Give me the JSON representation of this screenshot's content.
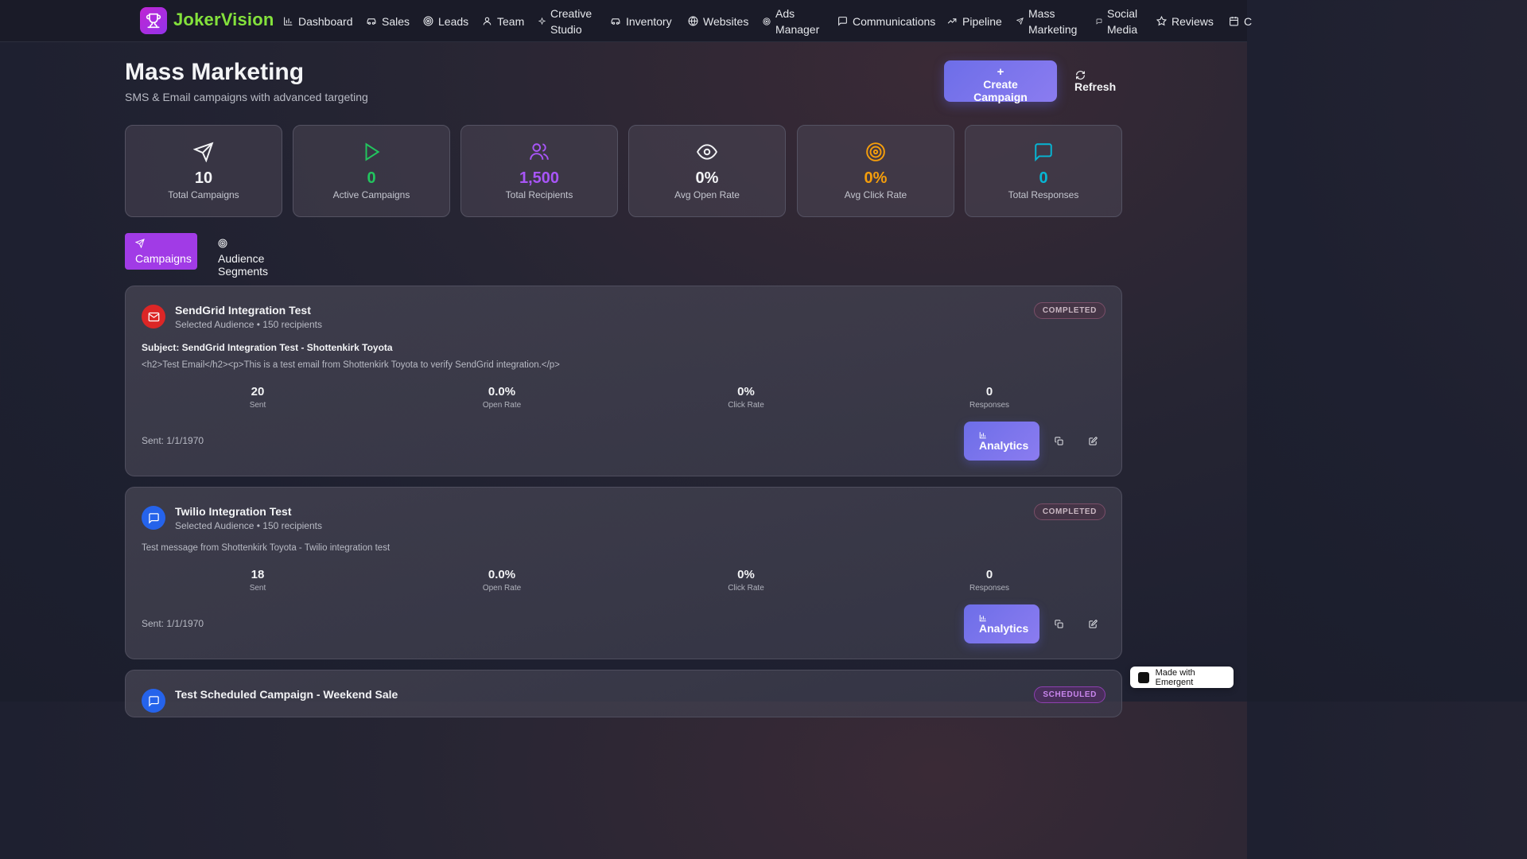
{
  "app": {
    "name": "JokerVision"
  },
  "nav": [
    {
      "label": "Dashboard",
      "icon": "bar-chart-icon"
    },
    {
      "label": "Sales",
      "icon": "car-icon"
    },
    {
      "label": "Leads",
      "icon": "target-icon"
    },
    {
      "label": "Team",
      "icon": "user-icon"
    },
    {
      "label": "Creative Studio",
      "icon": "sparkle-icon"
    },
    {
      "label": "Inventory",
      "icon": "car-icon"
    },
    {
      "label": "Websites",
      "icon": "globe-icon"
    },
    {
      "label": "Ads Manager",
      "icon": "target-icon"
    },
    {
      "label": "Communications",
      "icon": "message-icon"
    },
    {
      "label": "Pipeline",
      "icon": "trending-up-icon"
    },
    {
      "label": "Mass Marketing",
      "icon": "send-icon"
    },
    {
      "label": "Social Media",
      "icon": "message-icon"
    },
    {
      "label": "Reviews",
      "icon": "star-icon"
    },
    {
      "label": "C",
      "icon": "calendar-icon"
    }
  ],
  "header": {
    "title": "Mass Marketing",
    "subtitle": "SMS & Email campaigns with advanced targeting",
    "create_label": "Create Campaign",
    "refresh_label": "Refresh"
  },
  "stats": [
    {
      "value": "10",
      "label": "Total Campaigns",
      "color": "#f3f4f6",
      "icon": "send-icon"
    },
    {
      "value": "0",
      "label": "Active Campaigns",
      "color": "#22c55e",
      "icon": "play-icon"
    },
    {
      "value": "1,500",
      "label": "Total Recipients",
      "color": "#a855f7",
      "icon": "users-icon"
    },
    {
      "value": "0%",
      "label": "Avg Open Rate",
      "color": "#f3f4f6",
      "icon": "eye-icon"
    },
    {
      "value": "0%",
      "label": "Avg Click Rate",
      "color": "#f59e0b",
      "icon": "target-icon"
    },
    {
      "value": "0",
      "label": "Total Responses",
      "color": "#06b6d4",
      "icon": "message-icon"
    }
  ],
  "tabs": [
    {
      "label": "Campaigns",
      "active": true
    },
    {
      "label": "Audience Segments",
      "active": false
    }
  ],
  "campaigns": [
    {
      "title": "SendGrid Integration Test",
      "meta": "Selected Audience • 150 recipients",
      "status": "COMPLETED",
      "subject": "Subject: SendGrid Integration Test - Shottenkirk Toyota",
      "body": "<h2>Test Email</h2><p>This is a test email from Shottenkirk Toyota to verify SendGrid integration.</p>",
      "metrics": [
        {
          "value": "20",
          "label": "Sent"
        },
        {
          "value": "0.0%",
          "label": "Open Rate"
        },
        {
          "value": "0%",
          "label": "Click Rate"
        },
        {
          "value": "0",
          "label": "Responses"
        }
      ],
      "sent_date": "Sent: 1/1/1970",
      "analytics_label": "Analytics",
      "channel_color": "#dc2626"
    },
    {
      "title": "Twilio Integration Test",
      "meta": "Selected Audience • 150 recipients",
      "status": "COMPLETED",
      "body": "Test message from Shottenkirk Toyota - Twilio integration test",
      "metrics": [
        {
          "value": "18",
          "label": "Sent"
        },
        {
          "value": "0.0%",
          "label": "Open Rate"
        },
        {
          "value": "0%",
          "label": "Click Rate"
        },
        {
          "value": "0",
          "label": "Responses"
        }
      ],
      "sent_date": "Sent: 1/1/1970",
      "analytics_label": "Analytics",
      "channel_color": "#2563eb"
    },
    {
      "title": "Test Scheduled Campaign - Weekend Sale",
      "status": "SCHEDULED",
      "channel_color": "#2563eb"
    }
  ],
  "footer_badge": "Made with Emergent"
}
